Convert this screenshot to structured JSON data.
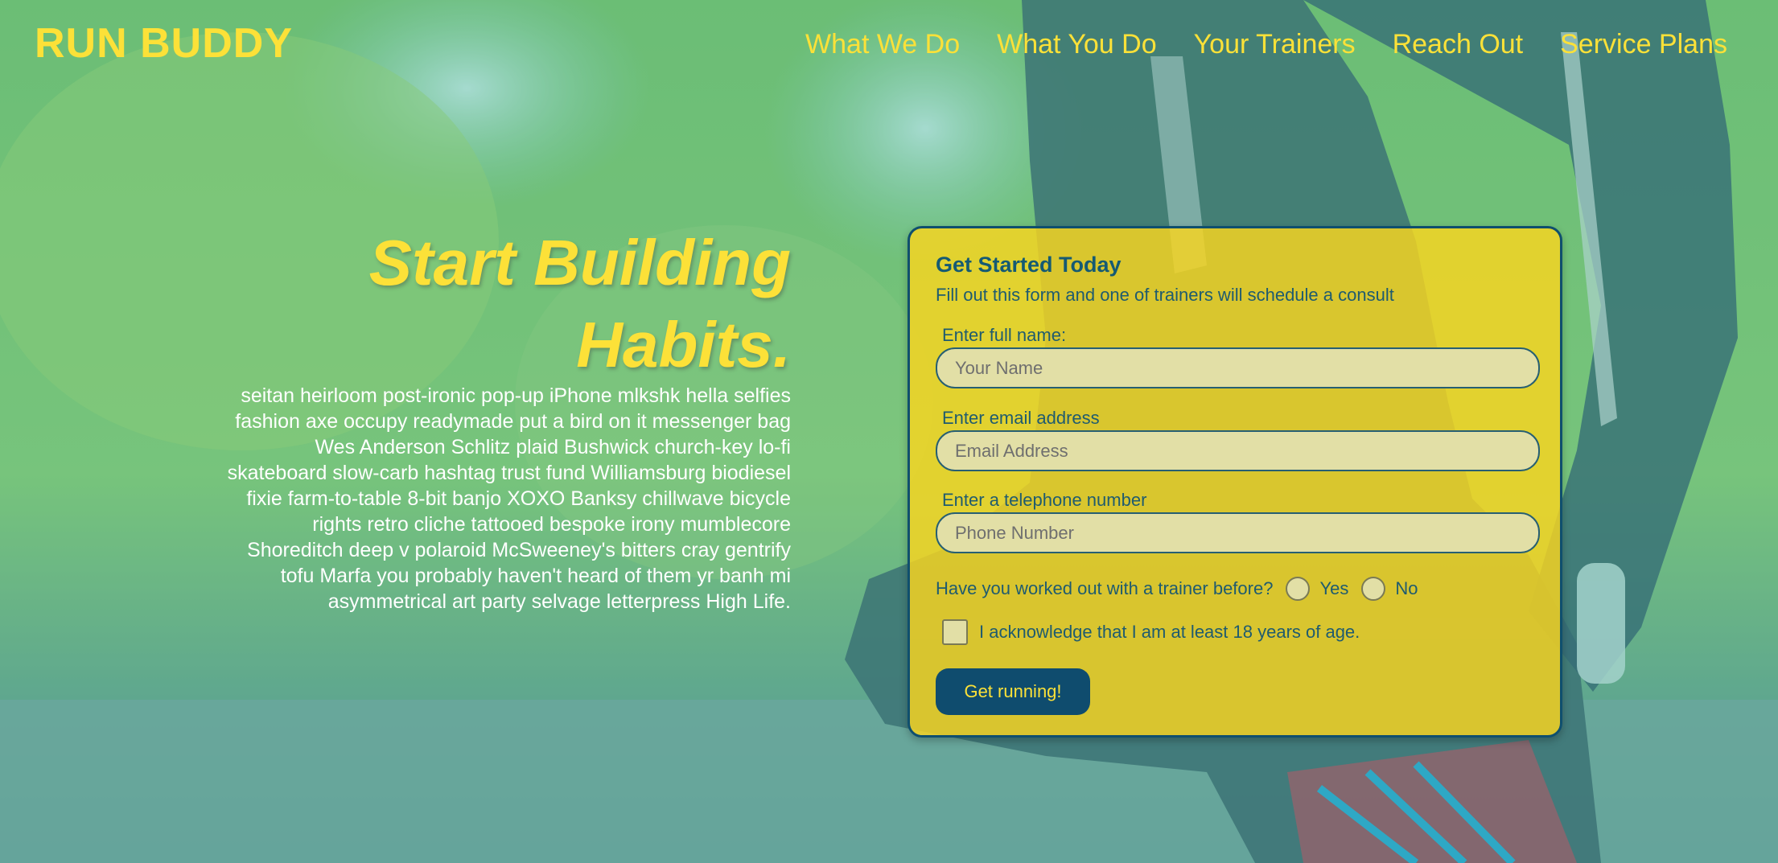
{
  "header": {
    "logo": "RUN BUDDY",
    "nav": [
      "What We Do",
      "What You Do",
      "Your Trainers",
      "Reach Out",
      "Service Plans"
    ]
  },
  "hero": {
    "headline": "Start Building Habits.",
    "body": "seitan heirloom post-ironic pop-up iPhone mlkshk hella selfies fashion axe occupy readymade put a bird on it messenger bag Wes Anderson Schlitz plaid Bushwick church-key lo-fi skateboard slow-carb hashtag trust fund Williamsburg biodiesel fixie farm-to-table 8-bit banjo XOXO Banksy chillwave bicycle rights retro cliche tattooed bespoke irony mumblecore Shoreditch deep v polaroid McSweeney's bitters cray gentrify tofu Marfa you probably haven't heard of them yr banh mi asymmetrical art party selvage letterpress High Life."
  },
  "form": {
    "title": "Get Started Today",
    "subtitle": "Fill out this form and one of trainers will schedule a consult",
    "name_label": "Enter full name:",
    "name_placeholder": "Your Name",
    "email_label": "Enter email address",
    "email_placeholder": "Email Address",
    "phone_label": "Enter a telephone number",
    "phone_placeholder": "Phone Number",
    "trainer_question": "Have you worked out with a trainer before?",
    "yes_label": "Yes",
    "no_label": "No",
    "acknowledge_label": "I acknowledge that I am at least 18 years of age.",
    "submit_label": "Get running!"
  },
  "colors": {
    "accent": "#fce138",
    "primary": "#0f4c6e",
    "card": "#fad61e"
  }
}
